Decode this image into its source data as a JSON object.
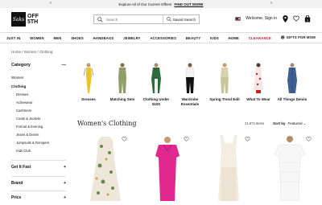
{
  "promo": {
    "text": "Explore All of Our Current Offers!",
    "link": "FIND OUT MORE"
  },
  "header": {
    "logo_script": "Saks",
    "logo_line1": "OFF",
    "logo_line2": "5TH",
    "search_placeholder": "Search",
    "saved_search": "Saved Search",
    "welcome": "Welcome, Sign in"
  },
  "nav": [
    "JUST IN",
    "WOMEN",
    "MEN",
    "SHOES",
    "HANDBAGS",
    "JEWELRY",
    "ACCESSORIES",
    "BEAUTY",
    "KIDS",
    "HOME",
    "CLEARANCE",
    "GIFTS FOR MOM"
  ],
  "breadcrumb": "Home / Women / Clothing",
  "sidebar": {
    "category_title": "Category",
    "items": [
      "Women",
      "Clothing"
    ],
    "subitems": [
      "Dresses",
      "Activewear",
      "Cashmere",
      "Coats & Jackets",
      "Formal & Evening",
      "Jeans & Denim",
      "Jumpsuits & Rompers",
      "Kids Club"
    ],
    "sections": [
      "Get It Fast",
      "Brand",
      "Price"
    ]
  },
  "categories": [
    "Dresses",
    "Matching Sets",
    "Clothing Under $100",
    "Wardrobe Essentials",
    "Spring Trend Edit",
    "What To Wear",
    "All Things Denim"
  ],
  "listing": {
    "title": "Women's Clothing",
    "count": "21,672 Items",
    "sort_label": "Sort by",
    "sort_value": "Featured"
  },
  "colors": {
    "accent": "#c8102e",
    "text": "#111111"
  }
}
